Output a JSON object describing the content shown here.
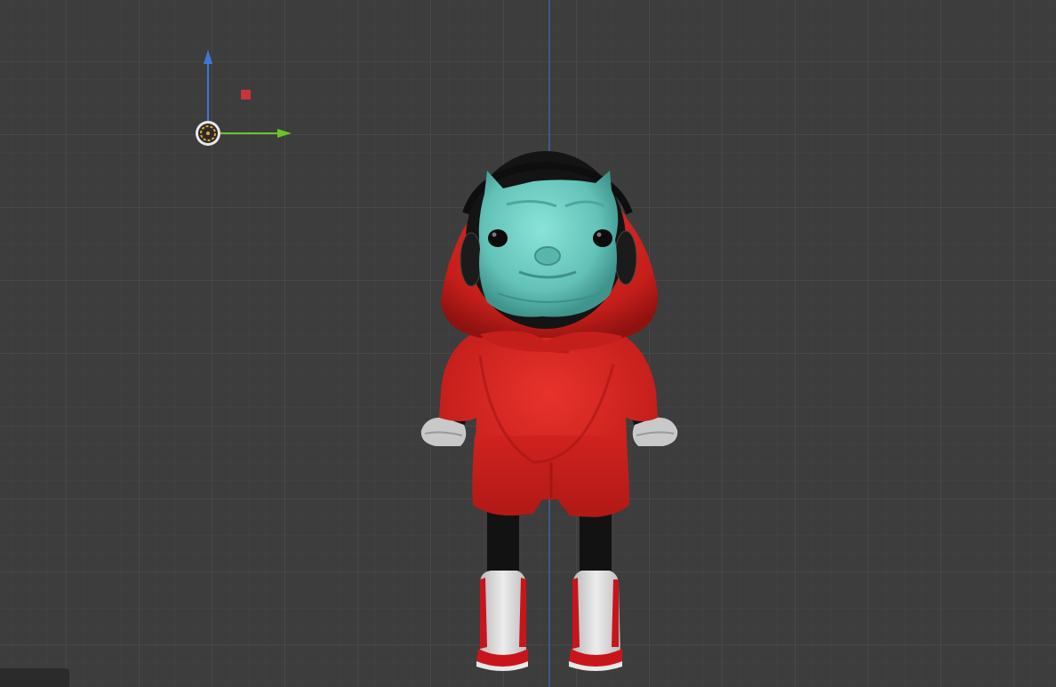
{
  "viewport": {
    "background": "#3d3d3d",
    "minor_grid_color": "#464646",
    "major_grid_color": "#505050",
    "z_axis_color": "#3f74c6",
    "y_axis_color": "#6bbf2a",
    "origin_color": "#f0a030"
  },
  "character": {
    "mask_color": "#6ecfc5",
    "hoodie_color": "#d42421",
    "legs_color": "#121212",
    "shoe_color": "#d8d8d8",
    "shoe_accent_color": "#c8151b",
    "headphone_color": "#151515"
  }
}
